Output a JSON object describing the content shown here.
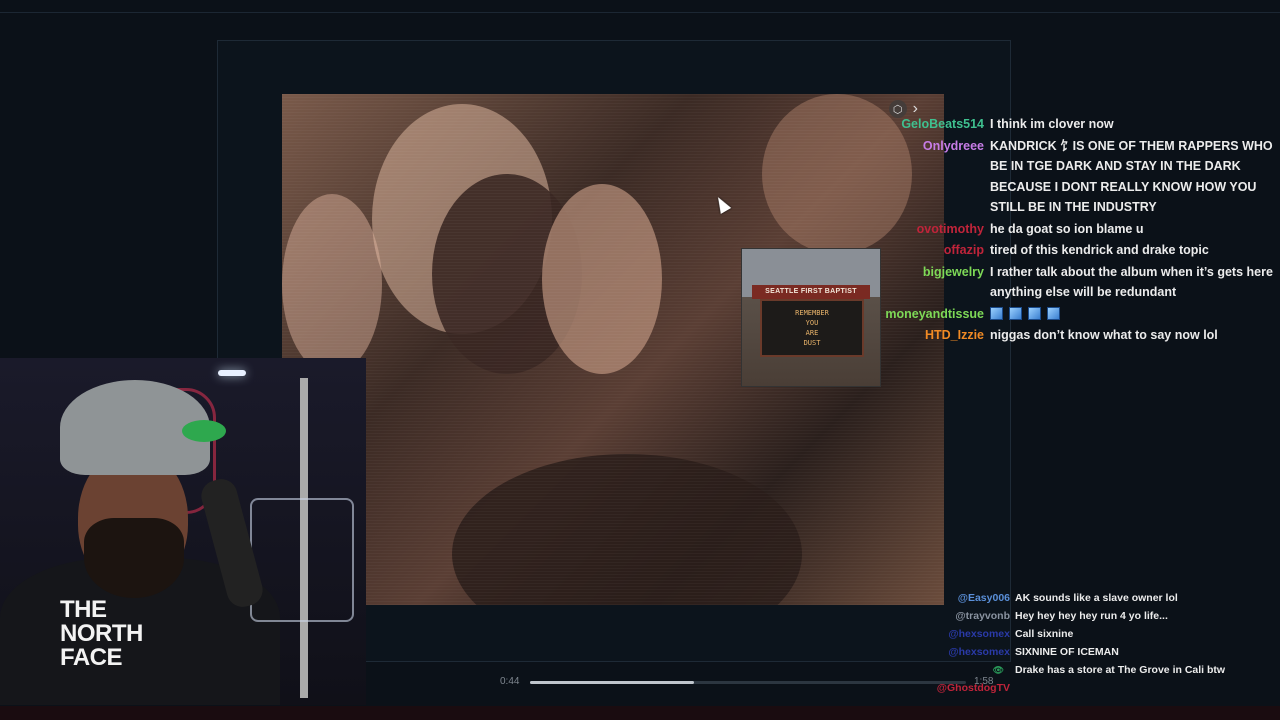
{
  "video": {
    "current_time": "0:44",
    "total_time": "1:58",
    "progress": 0.375,
    "sign_banner": "SEATTLE FIRST BAPTIST",
    "sign_lines": [
      "REMEMBER",
      "YOU",
      "ARE",
      "DUST"
    ]
  },
  "chat": {
    "messages": [
      {
        "user": "GeloBeats514",
        "color": "#3fc08f",
        "text": "I think im clover now"
      },
      {
        "user": "Onlydreee",
        "color": "#c77ce6",
        "text": "KANDRICK ⻠IS ONE OF THEM RAPPERS WHO BE IN TGE DARK AND STAY IN THE DARK BECAUSE I DONT REALLY KNOW HOW YOU STILL BE IN THE INDUSTRY"
      },
      {
        "user": "ovotimothy",
        "color": "#c0243a",
        "text": "he da goat so ion blame u"
      },
      {
        "user": "offazip",
        "color": "#c0243a",
        "text": "tired of this kendrick and drake topic"
      },
      {
        "user": "bigjewelry",
        "color": "#7ed957",
        "text": "I rather talk about the album when it’s gets here anything else will be redundant"
      },
      {
        "user": "moneyandtissue",
        "color": "#7ed957",
        "text": ""
      },
      {
        "user": "HTD_Izzie",
        "color": "#f08a24",
        "text": "niggas don’t know what to say now lol"
      }
    ],
    "secondary": [
      {
        "user": "@Easy006",
        "color": "#5a8fd8",
        "text": "AK sounds like a slave owner lol"
      },
      {
        "user": "@trayvonb",
        "color": "#8a93a0",
        "text": "Hey hey hey hey run 4 yo life..."
      },
      {
        "user": "@hexsomex",
        "color": "#2a3aa8",
        "text": "Call sixnine"
      },
      {
        "user": "@hexsomex",
        "color": "#2a3aa8",
        "text": "SIXNINE OF ICEMAN"
      },
      {
        "user": "@GhostdogTV",
        "color": "#c0243a",
        "text": "Drake has a store at The Grove in Cali btw"
      }
    ]
  },
  "webcam": {
    "logo_lines": [
      "THE",
      "NORTH",
      "FACE"
    ]
  },
  "icons": {
    "video_ext": "external-icon",
    "chevron": "chevron-right-icon",
    "cursor": "cursor-icon",
    "viewer": "eye-icon"
  }
}
